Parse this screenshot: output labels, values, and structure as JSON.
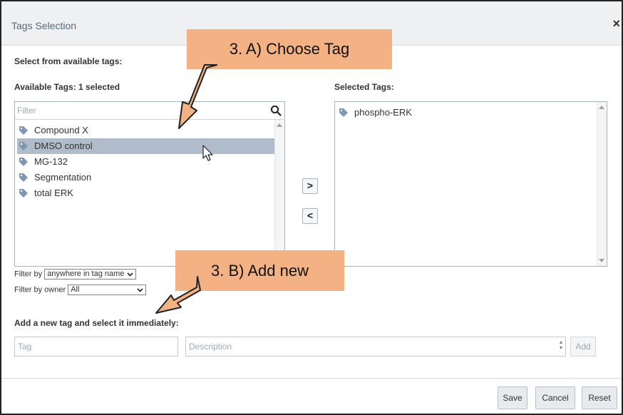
{
  "dialog": {
    "title": "Tags Selection",
    "close_symbol": "×"
  },
  "sections": {
    "select_from": "Select from available tags:",
    "available_header": "Available Tags: 1 selected",
    "selected_header": "Selected Tags:",
    "add_new_header": "Add a new tag and select it immediately:"
  },
  "filter": {
    "placeholder": "Filter",
    "icon": "search-icon"
  },
  "available_tags": [
    {
      "label": "Compound X",
      "selected": false
    },
    {
      "label": "DMSO control",
      "selected": true
    },
    {
      "label": "MG-132",
      "selected": false
    },
    {
      "label": "Segmentation",
      "selected": false
    },
    {
      "label": "total ERK",
      "selected": false
    }
  ],
  "selected_tags": [
    {
      "label": "phospho-ERK"
    }
  ],
  "move_buttons": {
    "add_symbol": ">",
    "remove_symbol": "<"
  },
  "filter_by": {
    "label": "Filter by",
    "value": "anywhere in tag name"
  },
  "filter_by_owner": {
    "label": "Filter by owner",
    "value": "All"
  },
  "new_tag": {
    "tag_placeholder": "Tag",
    "description_placeholder": "Description",
    "add_label": "Add"
  },
  "footer": {
    "save_label": "Save",
    "cancel_label": "Cancel",
    "reset_label": "Reset"
  },
  "annotations": {
    "choose_tag": "3. A) Choose Tag",
    "add_new": "3. B) Add new"
  },
  "colors": {
    "tag_icon": "#7f97b2",
    "selected_row": "#b0bcc9",
    "callout_bg": "#f4b183"
  }
}
